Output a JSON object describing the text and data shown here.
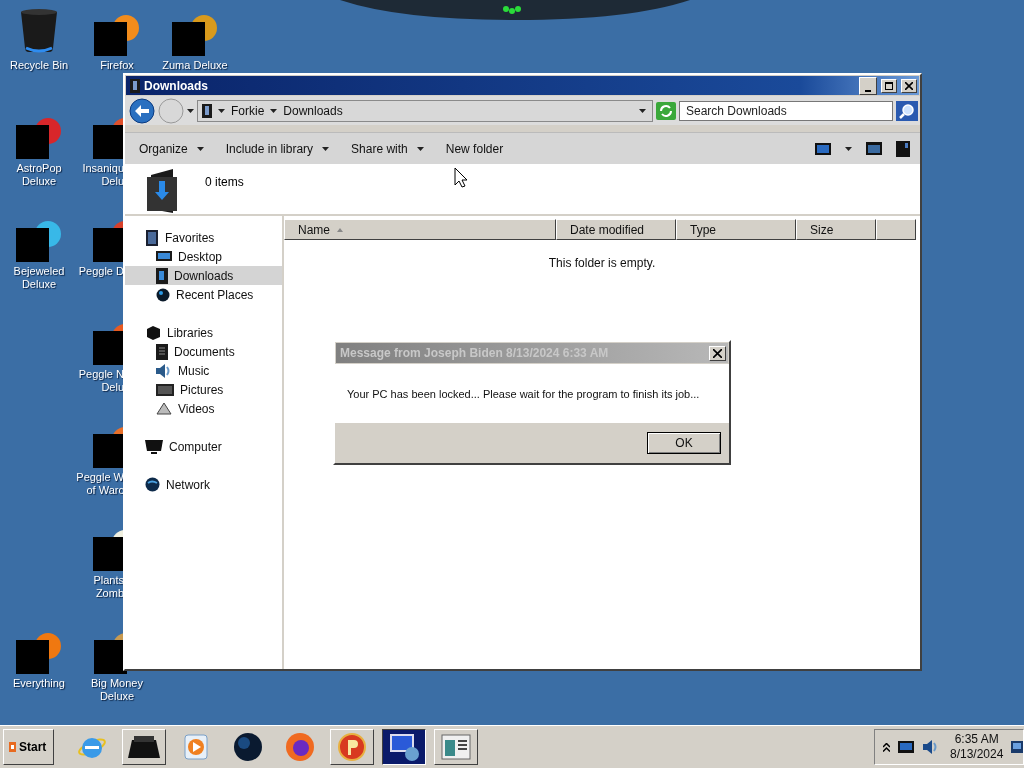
{
  "desktop": {
    "icons": [
      {
        "kind": "bin",
        "label": [
          "Recycle Bin"
        ]
      },
      {
        "kind": "redacted",
        "label": [
          "Firefox"
        ]
      },
      {
        "kind": "redacted",
        "label": [
          "Zuma Deluxe"
        ]
      },
      {
        "kind": "redacted",
        "label": [
          "AstroPop",
          "Deluxe"
        ]
      },
      {
        "kind": "redacted",
        "label": [
          "Insaniqu",
          "Delu"
        ]
      },
      {
        "kind": "redacted",
        "label": [
          "Bejeweled",
          "Deluxe"
        ]
      },
      {
        "kind": "redacted",
        "label": [
          "Peggle D"
        ]
      },
      {
        "kind": "redacted",
        "label": [
          "Peggle N",
          "Delu"
        ]
      },
      {
        "kind": "redacted",
        "label": [
          "Peggle W",
          "of Warc"
        ]
      },
      {
        "kind": "redacted",
        "label": [
          "Plants",
          "Zomb"
        ]
      },
      {
        "kind": "redacted",
        "label": [
          "Everything"
        ]
      },
      {
        "kind": "redacted",
        "label": [
          "Big Money",
          "Deluxe"
        ]
      }
    ]
  },
  "explorer": {
    "title": "Downloads",
    "breadcrumbs": [
      "Forkie",
      "Downloads"
    ],
    "search": {
      "placeholder": "Search Downloads"
    },
    "toolbar": [
      {
        "label": "Organize",
        "menu": true
      },
      {
        "label": "Include in library",
        "menu": true
      },
      {
        "label": "Share with",
        "menu": true
      },
      {
        "label": "New folder",
        "menu": false
      }
    ],
    "details": {
      "count": "0 items"
    },
    "nav": [
      {
        "kind": "favorites",
        "label": "Favorites",
        "selected": false,
        "children": [
          {
            "kind": "desktop",
            "label": "Desktop",
            "selected": false
          },
          {
            "kind": "downloads",
            "label": "Downloads",
            "selected": true
          },
          {
            "kind": "recent",
            "label": "Recent Places",
            "selected": false
          }
        ]
      },
      {
        "kind": "libraries",
        "label": "Libraries",
        "selected": false,
        "children": [
          {
            "kind": "documents",
            "label": "Documents",
            "selected": false
          },
          {
            "kind": "music",
            "label": "Music",
            "selected": false
          },
          {
            "kind": "pictures",
            "label": "Pictures",
            "selected": false
          },
          {
            "kind": "videos",
            "label": "Videos",
            "selected": false
          }
        ]
      },
      {
        "kind": "computer",
        "label": "Computer",
        "selected": false
      },
      {
        "kind": "network",
        "label": "Network",
        "selected": false
      }
    ],
    "columns": [
      {
        "label": "Name",
        "sorted": true
      },
      {
        "label": "Date modified",
        "sorted": false
      },
      {
        "label": "Type",
        "sorted": false
      },
      {
        "label": "Size",
        "sorted": false
      }
    ],
    "empty_message": "This folder is empty."
  },
  "dialog": {
    "title": "Message from Joseph Biden 8/13/2024 6:33 AM",
    "message": "Your PC has been locked... Please wait for the program to finish its job...",
    "buttons": [
      "OK"
    ]
  },
  "taskbar": {
    "start": "Start",
    "items": [
      {
        "kind": "browser-e",
        "open": false,
        "selected": false
      },
      {
        "kind": "dark-box",
        "open": true,
        "selected": false
      },
      {
        "kind": "media",
        "open": false,
        "selected": false
      },
      {
        "kind": "globe",
        "open": false,
        "selected": false
      },
      {
        "kind": "fox",
        "open": false,
        "selected": false
      },
      {
        "kind": "p-ball",
        "open": true,
        "selected": false
      },
      {
        "kind": "remote",
        "open": true,
        "selected": true
      },
      {
        "kind": "window",
        "open": true,
        "selected": false
      }
    ],
    "clock": {
      "time": "6:35 AM",
      "date": "8/13/2024"
    }
  }
}
